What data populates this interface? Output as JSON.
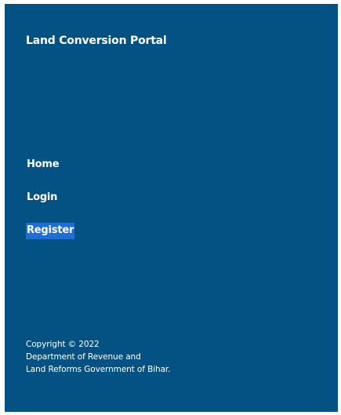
{
  "brand": {
    "title": "Land Conversion Portal"
  },
  "nav": {
    "items": [
      {
        "label": "Home"
      },
      {
        "label": "Login"
      },
      {
        "label": "Register",
        "selected": true
      }
    ]
  },
  "footer": {
    "line1": "Copyright © 2022",
    "line2": "Department of Revenue and",
    "line3": "Land Reforms Government of Bihar."
  },
  "colors": {
    "panel_background": "#035283",
    "selection_highlight": "#1e6fd1",
    "text": "#ffffff"
  }
}
